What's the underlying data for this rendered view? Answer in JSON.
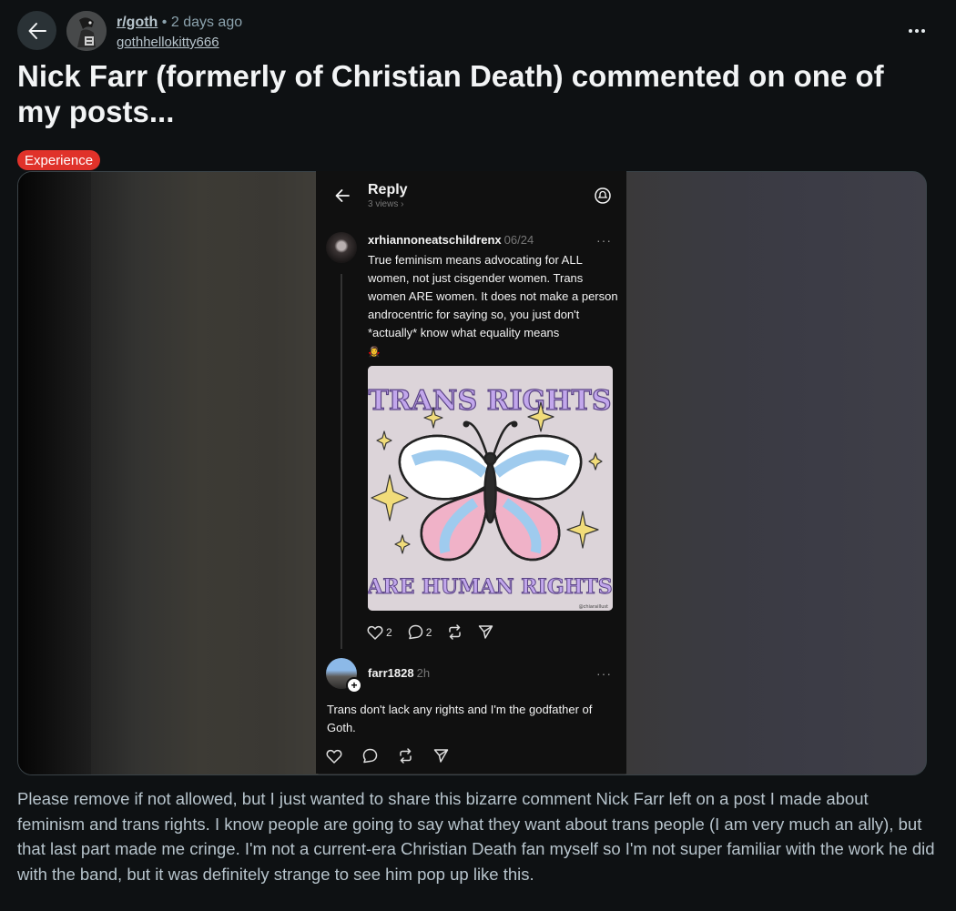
{
  "post": {
    "subreddit": "r/goth",
    "separator": "•",
    "time_ago": "2 days ago",
    "author": "gothhellokitty666",
    "title": "Nick Farr (formerly of Christian Death) commented on one of my posts...",
    "flair": "Experience",
    "flair_color": "#e0322a",
    "body": "Please remove if not allowed, but I just wanted to share this bizarre comment Nick Farr left on a post I made about feminism and trans rights. I know people are going to say what they want about trans people (I am very much an ally), but that last part made me cringe. I'm not a current-era Christian Death fan myself so I'm not super familiar with the work he did with the band, but it was definitely strange to see him pop up like this."
  },
  "icons": {
    "back": "arrow-left-icon",
    "more": "more-horizontal-icon",
    "reply_back": "arrow-left-icon",
    "bell": "notification-bell-icon",
    "heart": "heart-icon",
    "comment": "comment-bubble-icon",
    "repost": "repost-icon",
    "share": "send-icon"
  },
  "screenshot": {
    "header_title": "Reply",
    "views": "3 views",
    "comment1": {
      "username": "xrhiannoneatschildrenx",
      "date": "06/24",
      "more": "···",
      "text": "True feminism means advocating for ALL women, not just cisgender women. Trans women ARE women. It does not make a person androcentric for saying so, you just don't *actually* know what equality means",
      "emoji": "🧛‍♀️",
      "image_text_top": "TRANS RIGHTS",
      "image_text_bottom": "ARE HUMAN RIGHTS",
      "image_credit": "@chiaraillust",
      "likes": "2",
      "replies": "2"
    },
    "comment2": {
      "username": "farr1828",
      "date": "2h",
      "more": "···",
      "follow": "+",
      "text": "Trans don't lack any rights and I'm the godfather of Goth."
    }
  },
  "colors": {
    "background": "#0e1113",
    "text_primary": "#f2f4f5",
    "text_secondary": "#b7c4cc",
    "trans_blue": "#9fcbee",
    "trans_pink": "#f0b2c8",
    "star_yellow": "#f1dc7a",
    "lettering_purple": "#b79ae0"
  }
}
